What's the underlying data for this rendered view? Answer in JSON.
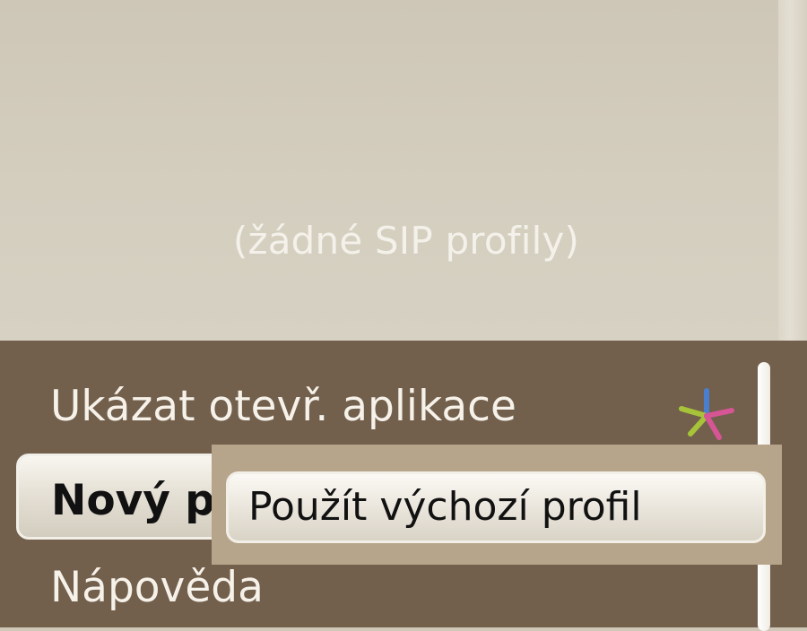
{
  "profile_area": {
    "empty_text": "(žádné SIP profily)"
  },
  "options_menu": {
    "items": [
      {
        "label": "Ukázat otevř. aplikace",
        "icon": "multitasking-star-icon"
      },
      {
        "label": "Nový p",
        "selected": true
      },
      {
        "label": "Nápověda"
      }
    ]
  },
  "submenu": {
    "item_label": "Použít výchozí profil"
  },
  "colors": {
    "menu_background": "#725f4c",
    "submenu_background": "#b7a58b",
    "upper_background": "#d4cebf"
  }
}
